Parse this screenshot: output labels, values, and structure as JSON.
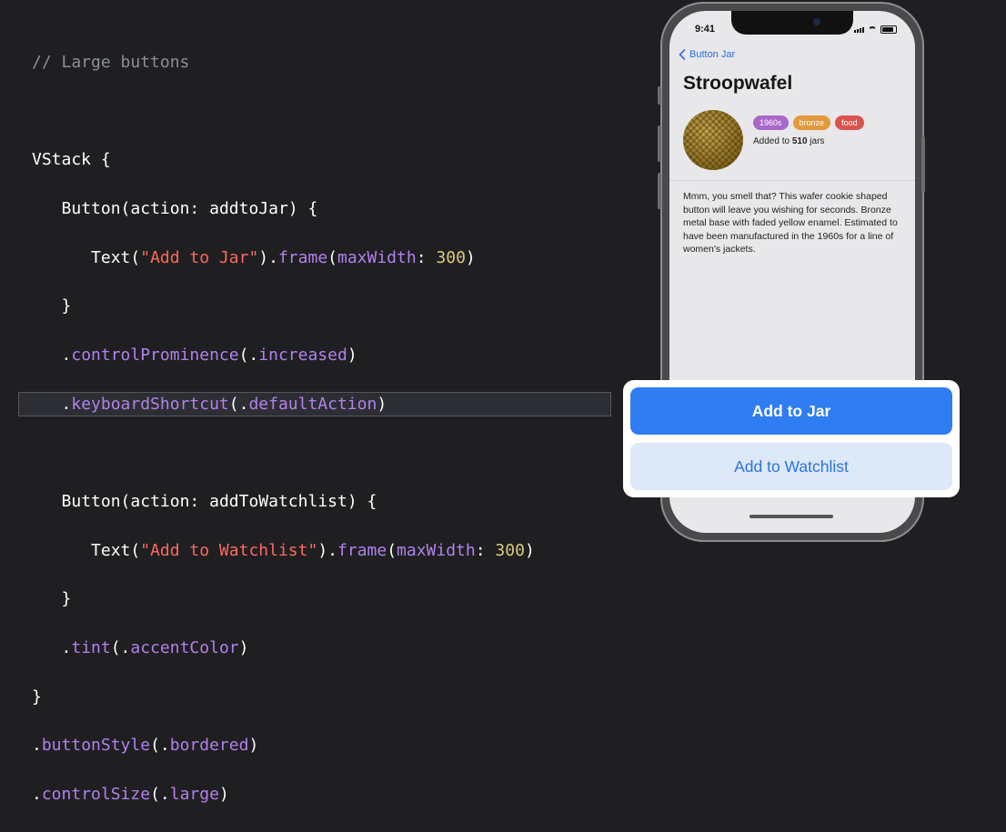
{
  "code": {
    "comment": "// Large buttons",
    "lines": {
      "vstack": "VStack",
      "button1_open": "Button",
      "button1_action_label": "action",
      "button1_action_value": "addtoJar",
      "text1_fn": "Text",
      "text1_str": "\"Add to Jar\"",
      "frame_fn": "frame",
      "maxwidth_label": "maxWidth",
      "maxwidth_value": "300",
      "control_prominence_fn": "controlProminence",
      "control_prominence_value": "increased",
      "keyboard_shortcut_fn": "keyboardShortcut",
      "keyboard_shortcut_value": "defaultAction",
      "button2_open": "Button",
      "button2_action_label": "action",
      "button2_action_value": "addToWatchlist",
      "text2_fn": "Text",
      "text2_str": "\"Add to Watchlist\"",
      "tint_fn": "tint",
      "tint_value": "accentColor",
      "button_style_fn": "buttonStyle",
      "button_style_value": "bordered",
      "control_size_fn": "controlSize",
      "control_size_value": "large"
    }
  },
  "phone": {
    "status_time": "9:41",
    "back_label": "Button Jar",
    "title": "Stroopwafel",
    "tags": [
      {
        "label": "1960s",
        "color": "#a868c8"
      },
      {
        "label": "bronze",
        "color": "#e39a3c"
      },
      {
        "label": "food",
        "color": "#d9534f"
      }
    ],
    "added_prefix": "Added to",
    "added_count": "510",
    "added_suffix": "jars",
    "description": "Mmm, you smell that? This wafer cookie shaped button will leave you wishing for seconds. Bronze metal base with faded yellow enamel. Estimated to have been manufactured in the 1960s for a line of women's jackets."
  },
  "buttons": {
    "primary_label": "Add to Jar",
    "secondary_label": "Add to Watchlist"
  },
  "colors": {
    "accent": "#2f7df0",
    "background": "#1f1f22"
  }
}
